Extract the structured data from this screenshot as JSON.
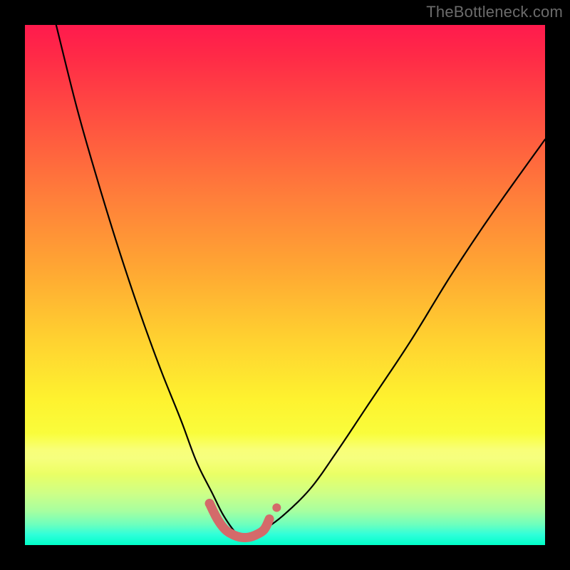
{
  "watermark": "TheBottleneck.com",
  "chart_data": {
    "type": "line",
    "title": "",
    "xlabel": "",
    "ylabel": "",
    "xlim": [
      0,
      100
    ],
    "ylim": [
      0,
      100
    ],
    "grid": false,
    "legend": false,
    "background": {
      "type": "vertical-gradient",
      "stops": [
        {
          "pos": 0,
          "color": "#ff1a4d",
          "meaning": "high-bottleneck"
        },
        {
          "pos": 50,
          "color": "#ffd030"
        },
        {
          "pos": 80,
          "color": "#f8ff3e"
        },
        {
          "pos": 100,
          "color": "#00ffc9",
          "meaning": "no-bottleneck"
        }
      ]
    },
    "series": [
      {
        "name": "bottleneck-curve",
        "color": "#000000",
        "x": [
          6,
          10,
          14,
          18,
          22,
          26,
          30,
          33,
          36,
          38,
          40,
          41.5,
          43,
          46,
          50,
          55,
          60,
          66,
          74,
          82,
          90,
          100
        ],
        "y": [
          100,
          84,
          70,
          57,
          45,
          34,
          24,
          16,
          10,
          6,
          3,
          1.5,
          1.5,
          3,
          6,
          11,
          18,
          27,
          39,
          52,
          64,
          78
        ]
      }
    ],
    "markers": [
      {
        "name": "optimal-range-highlight",
        "color": "#d46a6a",
        "type": "thick-segment",
        "x": [
          35.5,
          37,
          38.5,
          40,
          41.5,
          43,
          44.5,
          46,
          47
        ],
        "y": [
          8,
          5,
          3,
          2,
          1.5,
          1.5,
          2,
          3,
          5
        ]
      }
    ],
    "annotations": []
  }
}
